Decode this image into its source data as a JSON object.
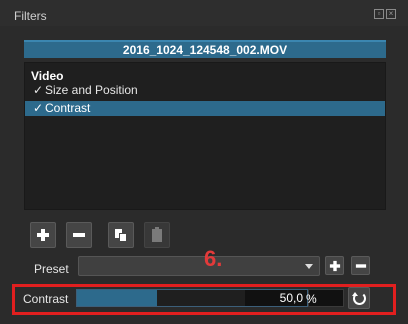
{
  "panel": {
    "title": "Filters",
    "icons": [
      "float-icon",
      "close-icon"
    ]
  },
  "clip": {
    "name": "2016_1024_124548_002.MOV"
  },
  "filters": {
    "header": "Video",
    "items": [
      {
        "label": "Size and Position",
        "checked": true,
        "selected": false
      },
      {
        "label": "Contrast",
        "checked": true,
        "selected": true
      }
    ]
  },
  "toolbar": {
    "buttons": [
      "add-icon",
      "remove-icon",
      "copy-icon",
      "paste-icon"
    ]
  },
  "preset": {
    "label": "Preset",
    "value": ""
  },
  "annotation": {
    "text": "6."
  },
  "contrast": {
    "label": "Contrast",
    "value_text": "50,0",
    "unit": "%",
    "level_percent": 50
  },
  "colors": {
    "accent": "#2d6a8c",
    "highlight": "#e11f1f",
    "annotation": "#e23a3a"
  }
}
